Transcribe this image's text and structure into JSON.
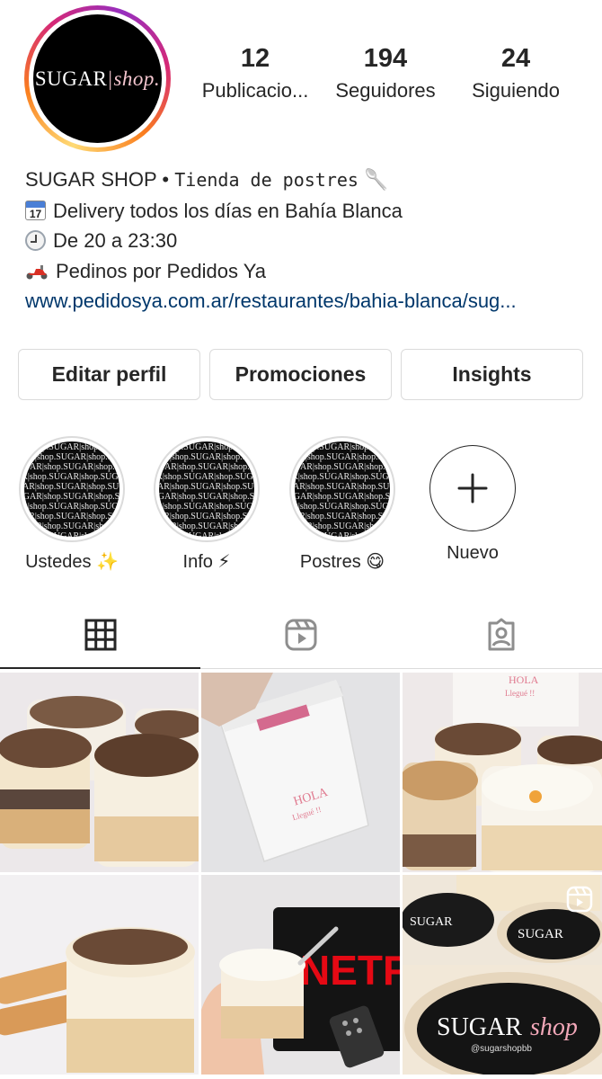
{
  "profile": {
    "logo_left": "SUGAR",
    "logo_sep": "|",
    "logo_right": "shop.",
    "stats": [
      {
        "number": "12",
        "label": "Publicacio..."
      },
      {
        "number": "194",
        "label": "Seguidores"
      },
      {
        "number": "24",
        "label": "Siguiendo"
      }
    ]
  },
  "bio": {
    "name": "SUGAR SHOP",
    "separator": " • ",
    "category": "Tienda de postres",
    "category_emoji": "🥄",
    "calendar_day": "17",
    "line1": "Delivery todos los días en Bahía Blanca",
    "line2": "De 20 a 23:30",
    "line3": "Pedinos por Pedidos Ya",
    "link": "www.pedidosya.com.ar/restaurantes/bahia-blanca/sug..."
  },
  "buttons": {
    "edit": "Editar perfil",
    "promotions": "Promociones",
    "insights": "Insights"
  },
  "highlights": [
    {
      "label": "Ustedes ✨"
    },
    {
      "label": "Info ⚡"
    },
    {
      "label": "Postres 😋"
    }
  ],
  "highlight_new": {
    "label": "Nuevo"
  },
  "highlight_pattern_text": "SUGAR|shop.",
  "grid_texts": {
    "bag_line1": "HOLA",
    "bag_line2": "Llegué !!",
    "card_line1": "HOLA",
    "card_line2": "Llegué !!",
    "tv_text": "NETF",
    "lid_left": "SUGAR",
    "lid_right": "shop",
    "lid_handle": "@sugarshopbb"
  },
  "colors": {
    "link": "#00376b",
    "text": "#262626",
    "border": "#dbdbdb",
    "accent_pink": "#d62976"
  },
  "icons": [
    "grid-icon",
    "reels-icon",
    "tagged-icon",
    "plus-icon",
    "reel-badge-icon"
  ]
}
